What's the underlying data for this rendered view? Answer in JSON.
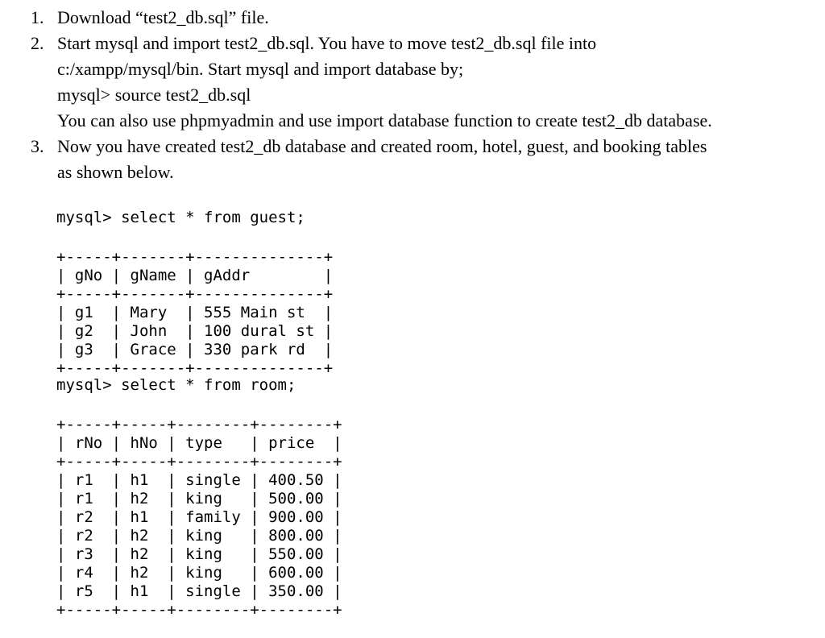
{
  "steps": [
    {
      "number": "1.",
      "lines": [
        "Download “test2_db.sql” file."
      ]
    },
    {
      "number": "2.",
      "lines": [
        "Start mysql and import test2_db.sql. You have to move test2_db.sql file into",
        "c:/xampp/mysql/bin.  Start mysql and import database by;",
        "mysql> source test2_db.sql",
        "You can also use phpmyadmin and use import database function to create test2_db database."
      ]
    },
    {
      "number": "3.",
      "lines": [
        "Now you have created test2_db database and created room, hotel, guest, and booking tables",
        "as shown below."
      ]
    }
  ],
  "guest_query": {
    "prompt": "mysql> select * from guest;",
    "table": [
      "+-----+-------+--------------+",
      "| gNo | gName | gAddr        |",
      "+-----+-------+--------------+",
      "| g1  | Mary  | 555 Main st  |",
      "| g2  | John  | 100 dural st |",
      "| g3  | Grace | 330 park rd  |",
      "+-----+-------+--------------+"
    ]
  },
  "room_query": {
    "prompt": "mysql> select * from room;",
    "table": [
      "+-----+-----+--------+--------+",
      "| rNo | hNo | type   | price  |",
      "+-----+-----+--------+--------+",
      "| r1  | h1  | single | 400.50 |",
      "| r1  | h2  | king   | 500.00 |",
      "| r2  | h1  | family | 900.00 |",
      "| r2  | h2  | king   | 800.00 |",
      "| r3  | h2  | king   | 550.00 |",
      "| r4  | h2  | king   | 600.00 |",
      "| r5  | h1  | single | 350.00 |",
      "+-----+-----+--------+--------+"
    ]
  }
}
